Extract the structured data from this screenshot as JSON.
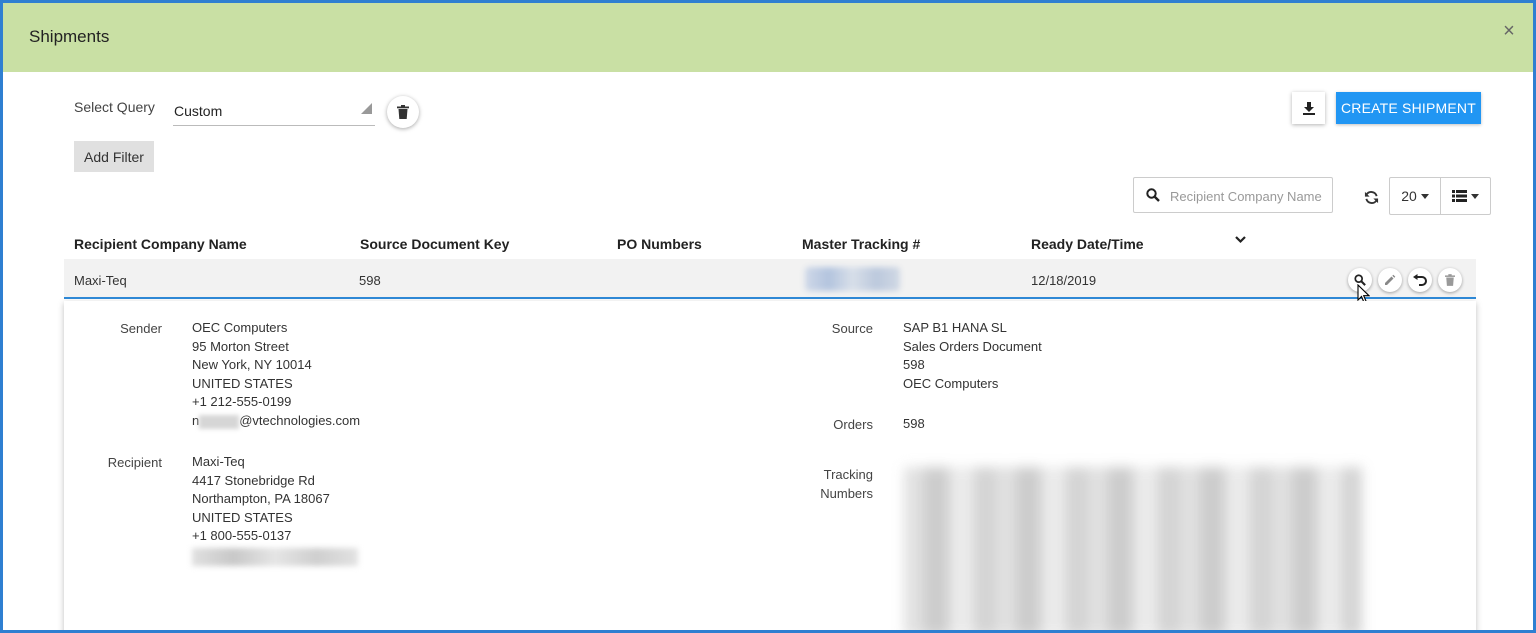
{
  "header": {
    "title": "Shipments",
    "close_glyph": "×"
  },
  "query": {
    "label": "Select Query",
    "value": "Custom"
  },
  "filters": {
    "add_label": "Add Filter"
  },
  "toolbar": {
    "create_label": "CREATE SHIPMENT",
    "download_icon": "download-icon"
  },
  "search": {
    "placeholder": "Recipient Company Name",
    "value": ""
  },
  "pagination": {
    "page_size": "20"
  },
  "table": {
    "columns": [
      "Recipient Company Name",
      "Source Document Key",
      "PO Numbers",
      "Master Tracking #",
      "Ready Date/Time"
    ],
    "rows": [
      {
        "recipient": "Maxi-Teq",
        "source_key": "598",
        "po_numbers": "",
        "master_tracking": "",
        "ready_date": "12/18/2019"
      }
    ]
  },
  "detail": {
    "sender": {
      "label": "Sender",
      "lines": [
        "OEC Computers",
        "95 Morton Street",
        "New York, NY 10014",
        "UNITED STATES",
        "+1 212-555-0199"
      ],
      "email_visible": "@vtechnologies.com",
      "email_prefix": "n"
    },
    "recipient": {
      "label": "Recipient",
      "lines": [
        "Maxi-Teq",
        "4417 Stonebridge Rd",
        "Northampton, PA 18067",
        "UNITED STATES",
        "+1 800-555-0137"
      ]
    },
    "source": {
      "label": "Source",
      "lines": [
        "SAP B1 HANA SL",
        "Sales Orders Document",
        "598",
        "OEC Computers"
      ]
    },
    "orders": {
      "label": "Orders",
      "value": "598"
    },
    "tracking": {
      "label_line1": "Tracking",
      "label_line2": "Numbers"
    }
  },
  "colors": {
    "header_bg": "#c9e0a4",
    "accent": "#2196f3",
    "frame": "#2f7fd1"
  }
}
